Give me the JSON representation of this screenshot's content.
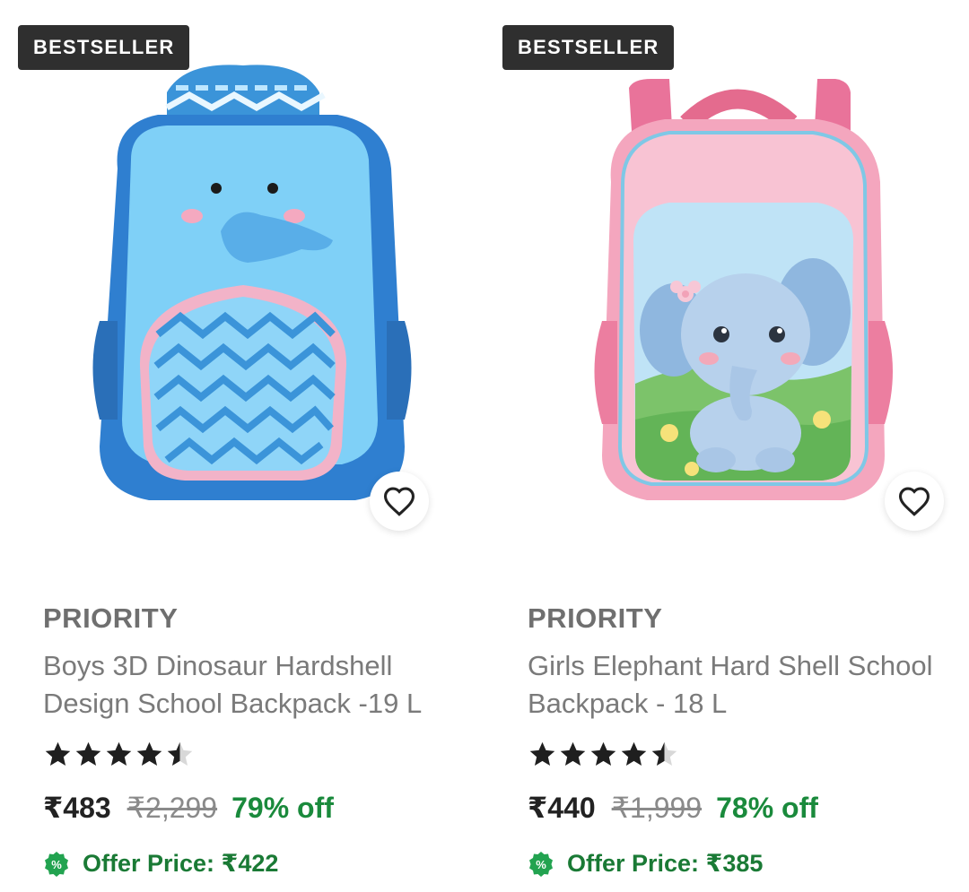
{
  "products": [
    {
      "badge": "BESTSELLER",
      "brand": "PRIORITY",
      "title": "Boys 3D Dinosaur Hardshell Design School Backpack -19 L",
      "rating": 4.5,
      "price": "₹483",
      "mrp": "₹2,299",
      "discount": "79% off",
      "offer_price": "Offer Price: ₹422",
      "image": "blue-elephant-backpack",
      "colors": {
        "bag": "#3fa3e6",
        "bag_light": "#7fd0f7",
        "trim": "#f4b6c8"
      }
    },
    {
      "badge": "BESTSELLER",
      "brand": "PRIORITY",
      "title": "Girls Elephant Hard Shell School Backpack - 18 L",
      "rating": 4.5,
      "price": "₹440",
      "mrp": "₹1,999",
      "discount": "78% off",
      "offer_price": "Offer Price: ₹385",
      "image": "pink-elephant-backpack",
      "colors": {
        "bag": "#f3a6bd",
        "bag_light": "#fbd0dd",
        "trim": "#e86d8f"
      }
    }
  ],
  "icons": {
    "wishlist": "heart-outline-icon",
    "rating": "star-icon",
    "offer": "percent-badge-icon"
  },
  "accent": {
    "discount": "#1a8a3c",
    "badge_bg": "#2f2f2f"
  }
}
